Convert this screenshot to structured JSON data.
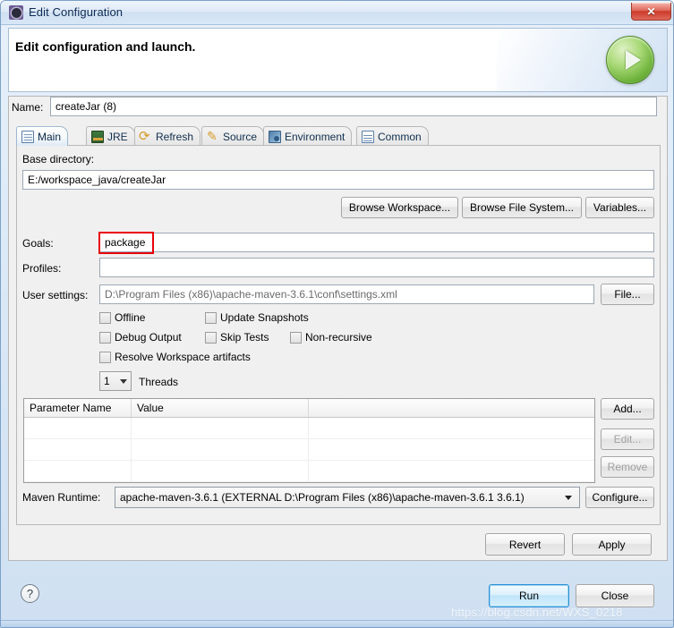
{
  "window": {
    "title": "Edit Configuration",
    "app_icon": "gear-icon",
    "close_label": "✕"
  },
  "header": {
    "title": "Edit configuration and launch.",
    "run_badge_icon": "green-play-icon"
  },
  "name_row": {
    "label": "Name:",
    "value": "createJar (8)"
  },
  "tabs": [
    {
      "label": "Main",
      "icon": "main-icon",
      "active": true
    },
    {
      "label": "JRE",
      "icon": "jre-icon",
      "active": false
    },
    {
      "label": "Refresh",
      "icon": "refresh-icon",
      "active": false
    },
    {
      "label": "Source",
      "icon": "source-icon",
      "active": false
    },
    {
      "label": "Environment",
      "icon": "environment-icon",
      "active": false
    },
    {
      "label": "Common",
      "icon": "common-icon",
      "active": false
    }
  ],
  "main_tab": {
    "base_directory": {
      "label": "Base directory:",
      "value": "E:/workspace_java/createJar"
    },
    "browse_workspace_label": "Browse Workspace...",
    "browse_filesystem_label": "Browse File System...",
    "variables_label": "Variables...",
    "goals": {
      "label": "Goals:",
      "value": "package",
      "highlight_color": "#e8000b"
    },
    "profiles": {
      "label": "Profiles:",
      "value": ""
    },
    "user_settings": {
      "label": "User settings:",
      "value": "D:\\Program Files (x86)\\apache-maven-3.6.1\\conf\\settings.xml",
      "button_label": "File..."
    },
    "checkboxes": [
      {
        "label": "Offline",
        "checked": false
      },
      {
        "label": "Update Snapshots",
        "checked": false
      },
      {
        "label": "Debug Output",
        "checked": false
      },
      {
        "label": "Skip Tests",
        "checked": false
      },
      {
        "label": "Non-recursive",
        "checked": false
      },
      {
        "label": "Resolve Workspace artifacts",
        "checked": false
      }
    ],
    "threads": {
      "value": "1",
      "label": "Threads"
    },
    "parameter_table": {
      "columns": [
        "Parameter Name",
        "Value",
        ""
      ],
      "rows": [
        [
          "",
          "",
          ""
        ],
        [
          "",
          "",
          ""
        ],
        [
          "",
          "",
          ""
        ]
      ]
    },
    "table_buttons": {
      "add": "Add...",
      "edit": "Edit...",
      "remove": "Remove"
    },
    "maven_runtime": {
      "label": "Maven Runtime:",
      "value": "apache-maven-3.6.1 (EXTERNAL D:\\Program Files (x86)\\apache-maven-3.6.1 3.6.1)",
      "configure_label": "Configure..."
    }
  },
  "footer": {
    "revert_label": "Revert",
    "apply_label": "Apply",
    "help_label": "?",
    "run_label": "Run",
    "close_label": "Close",
    "watermark": "https://blog.csdn.net/WXS_0218"
  }
}
